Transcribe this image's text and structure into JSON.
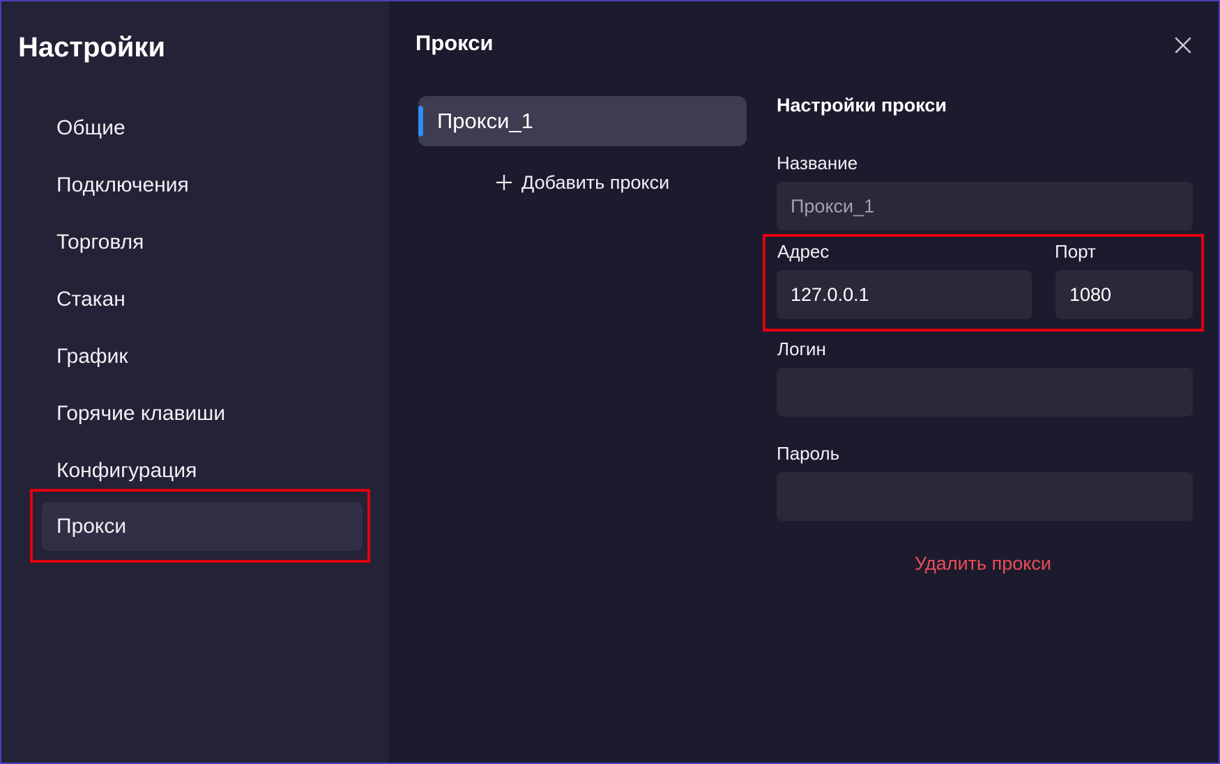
{
  "sidebar": {
    "title": "Настройки",
    "items": [
      {
        "label": "Общие"
      },
      {
        "label": "Подключения"
      },
      {
        "label": "Торговля"
      },
      {
        "label": "Стакан"
      },
      {
        "label": "График"
      },
      {
        "label": "Горячие клавиши"
      },
      {
        "label": "Конфигурация"
      },
      {
        "label": "Прокси",
        "active": true
      }
    ]
  },
  "section": {
    "title": "Прокси",
    "close_icon": "close-icon"
  },
  "proxy_list": {
    "items": [
      {
        "label": "Прокси_1",
        "selected": true
      }
    ],
    "add_label": "Добавить прокси",
    "add_icon": "plus-icon"
  },
  "proxy_settings": {
    "title": "Настройки прокси",
    "name": {
      "label": "Название",
      "value": "Прокси_1"
    },
    "address": {
      "label": "Адрес",
      "value": "127.0.0.1"
    },
    "port": {
      "label": "Порт",
      "value": "1080"
    },
    "login": {
      "label": "Логин",
      "value": ""
    },
    "password": {
      "label": "Пароль",
      "value": ""
    },
    "delete_label": "Удалить прокси"
  },
  "colors": {
    "window_bg": "#1c1b2e",
    "sidebar_bg": "#232236",
    "accent": "#2f8df5",
    "danger": "#ee4c55",
    "annotation": "#e3000f"
  }
}
